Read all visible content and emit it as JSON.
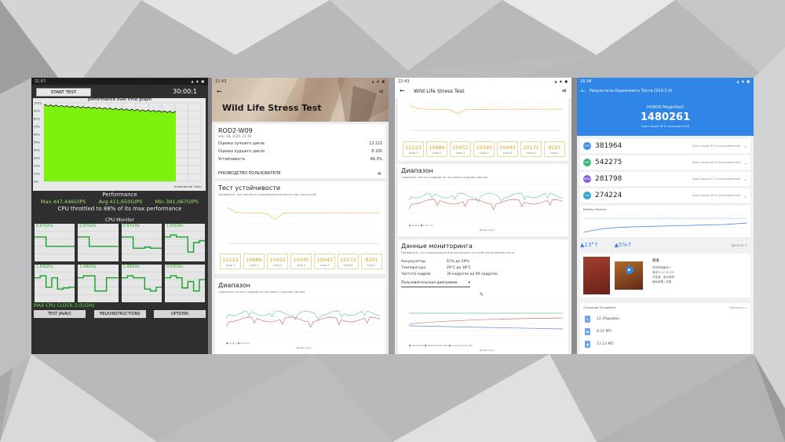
{
  "colors": {
    "accent_green": "#5fd84a",
    "antutu_blue": "#2f86e7",
    "loop_yellow": "#d9a521"
  },
  "phone1": {
    "status_time": "21:57",
    "status_icons": "▲ ◆ ■",
    "start_label": "START TEST",
    "timer": "30:00:1",
    "graph_title": "performance over time graph",
    "y_ticks": [
      "100%",
      "90%",
      "80%",
      "70%",
      "60%",
      "50%",
      "40%",
      "30%",
      "20%",
      "10%",
      "0%"
    ],
    "x_label": "time(interval 1min)",
    "perf_title": "Performance",
    "max": "Max 447,446GIPS",
    "avg": "Avg 411,650GIPS",
    "min": "Min 391,067GIPS",
    "throttle": "CPU throttled to 88% of its max performance",
    "cpu_title": "CPU Monitor",
    "cores": [
      "0.87GHz",
      "0.87GHz",
      "0.87GHz",
      "1.83GHz",
      "1.83GHz",
      "1.48GHz",
      "1.48GHz",
      "0.93GHz"
    ],
    "max_clock": "MAX CPU CLOCK:3.01GHz",
    "buttons": [
      "TEST JAVA/C",
      "HELP/INSTRUCTIONS",
      "OPTIONS"
    ]
  },
  "phone2": {
    "status_time": "22:43",
    "status_icons": "▲ ◆ ■",
    "title": "Wild Life Stress Test",
    "device": "ROD2-W09",
    "date": "апр. 28, 2024, 21:10",
    "best_label": "Оценка лучшего цикла",
    "best_val": "12 223",
    "worst_label": "Оценка худшего цикла",
    "worst_val": "8 100",
    "stab_label": "Устойчивость",
    "stab_val": "66.3%",
    "guide": "РУКОВОДСТВО ПОЛЬЗОВАТЕЛЯ",
    "stab_title": "Тест устойчивости",
    "stab_sub": "Проверьте, как меняется производительность под нагрузкой",
    "loops": [
      {
        "v": "12223",
        "l": "Loop 1"
      },
      {
        "v": "10686",
        "l": "Loop 2"
      },
      {
        "v": "10452",
        "l": "Loop 3"
      },
      {
        "v": "10340",
        "l": "Loop 4"
      },
      {
        "v": "10443",
        "l": "Loop 5"
      },
      {
        "v": "10172",
        "l": "Loop 6"
      },
      {
        "v": "8201",
        "l": "Loop 7"
      }
    ],
    "range_title": "Диапазон",
    "range_sub": "Сравните частоту кадров на лучшем и худшем циклах",
    "range_legend": "● Loop 1  ● Loop 11",
    "range_xlabel": "Время (сек.)"
  },
  "phone3": {
    "status_time": "22:43",
    "status_icons": "▲ ◆ ■",
    "title": "Wild Life Stress Test",
    "loops": [
      {
        "v": "12223",
        "l": "Loop 1"
      },
      {
        "v": "10686",
        "l": "Loop 2"
      },
      {
        "v": "10452",
        "l": "Loop 3"
      },
      {
        "v": "10340",
        "l": "Loop 4"
      },
      {
        "v": "10443",
        "l": "Loop 5"
      },
      {
        "v": "10172",
        "l": "Loop 6"
      },
      {
        "v": "8201",
        "l": "Loop 7"
      }
    ],
    "range_title": "Диапазон",
    "range_sub": "Сравните частоту кадров на лучшем и худшем циклах",
    "range_legend": "● Loop 1  ● Loop 11",
    "range_xlabel": "Время (сек.)",
    "mon_title": "Данные мониторинга",
    "mon_sub": "Проверьте, что происходило внутри вашего устройства во время теста",
    "mon_rows": [
      {
        "k": "Аккумулятор",
        "v": "67% до 59%"
      },
      {
        "k": "Температура",
        "v": "29°C до 38°C"
      },
      {
        "k": "Частота кадров",
        "v": "30 кадр/сек до 90 кадр/сек"
      }
    ],
    "mon_select": "Пользовательская диаграмма",
    "mon_legend": "● Clock/Ход  ● Температура ЦП  ● Аккумулятор ЦП",
    "mon_xlabel": "Время (сек.)"
  },
  "phone4": {
    "status_time": "16:38",
    "status_icons": "▲ ◆ ■",
    "title": "Результаты Оценочного Теста (V10.3.4)",
    "model": "HONOR MagicPad2",
    "score": "1480261",
    "note": "Здесь выше 36 % пользователей",
    "subs": [
      {
        "v": "381964",
        "c": "#3f8ee8",
        "tag": "CPU",
        "note": "Здесь выше 67 % пользователей"
      },
      {
        "v": "542275",
        "c": "#32b67a",
        "tag": "GPU",
        "note": "Здесь выше 86 % пользователей"
      },
      {
        "v": "281798",
        "c": "#8a5bd6",
        "tag": "MEM",
        "note": "Здесь выше 57 % пользователей"
      },
      {
        "v": "274224",
        "c": "#31a5d4",
        "tag": "UX",
        "note": "Здесь выше 48 % пользователей"
      }
    ],
    "mon_title": "Battery Monitor",
    "temp_up": "▲13°↑",
    "temp_battery": "▲5%↑",
    "temp_detail": "Детали >",
    "ad_name": "橙发",
    "ad_lines": [
      "所有物语版本+",
      "版本5.2.2 10.20",
      "开发者：南京新网",
      "隐私政策 | 权限"
    ],
    "info_title": "Описание Устройств",
    "info_more": "Показать >",
    "info_rows": [
      "12.29дюйма",
      "8.22 МП",
      "13.13 МП"
    ]
  }
}
